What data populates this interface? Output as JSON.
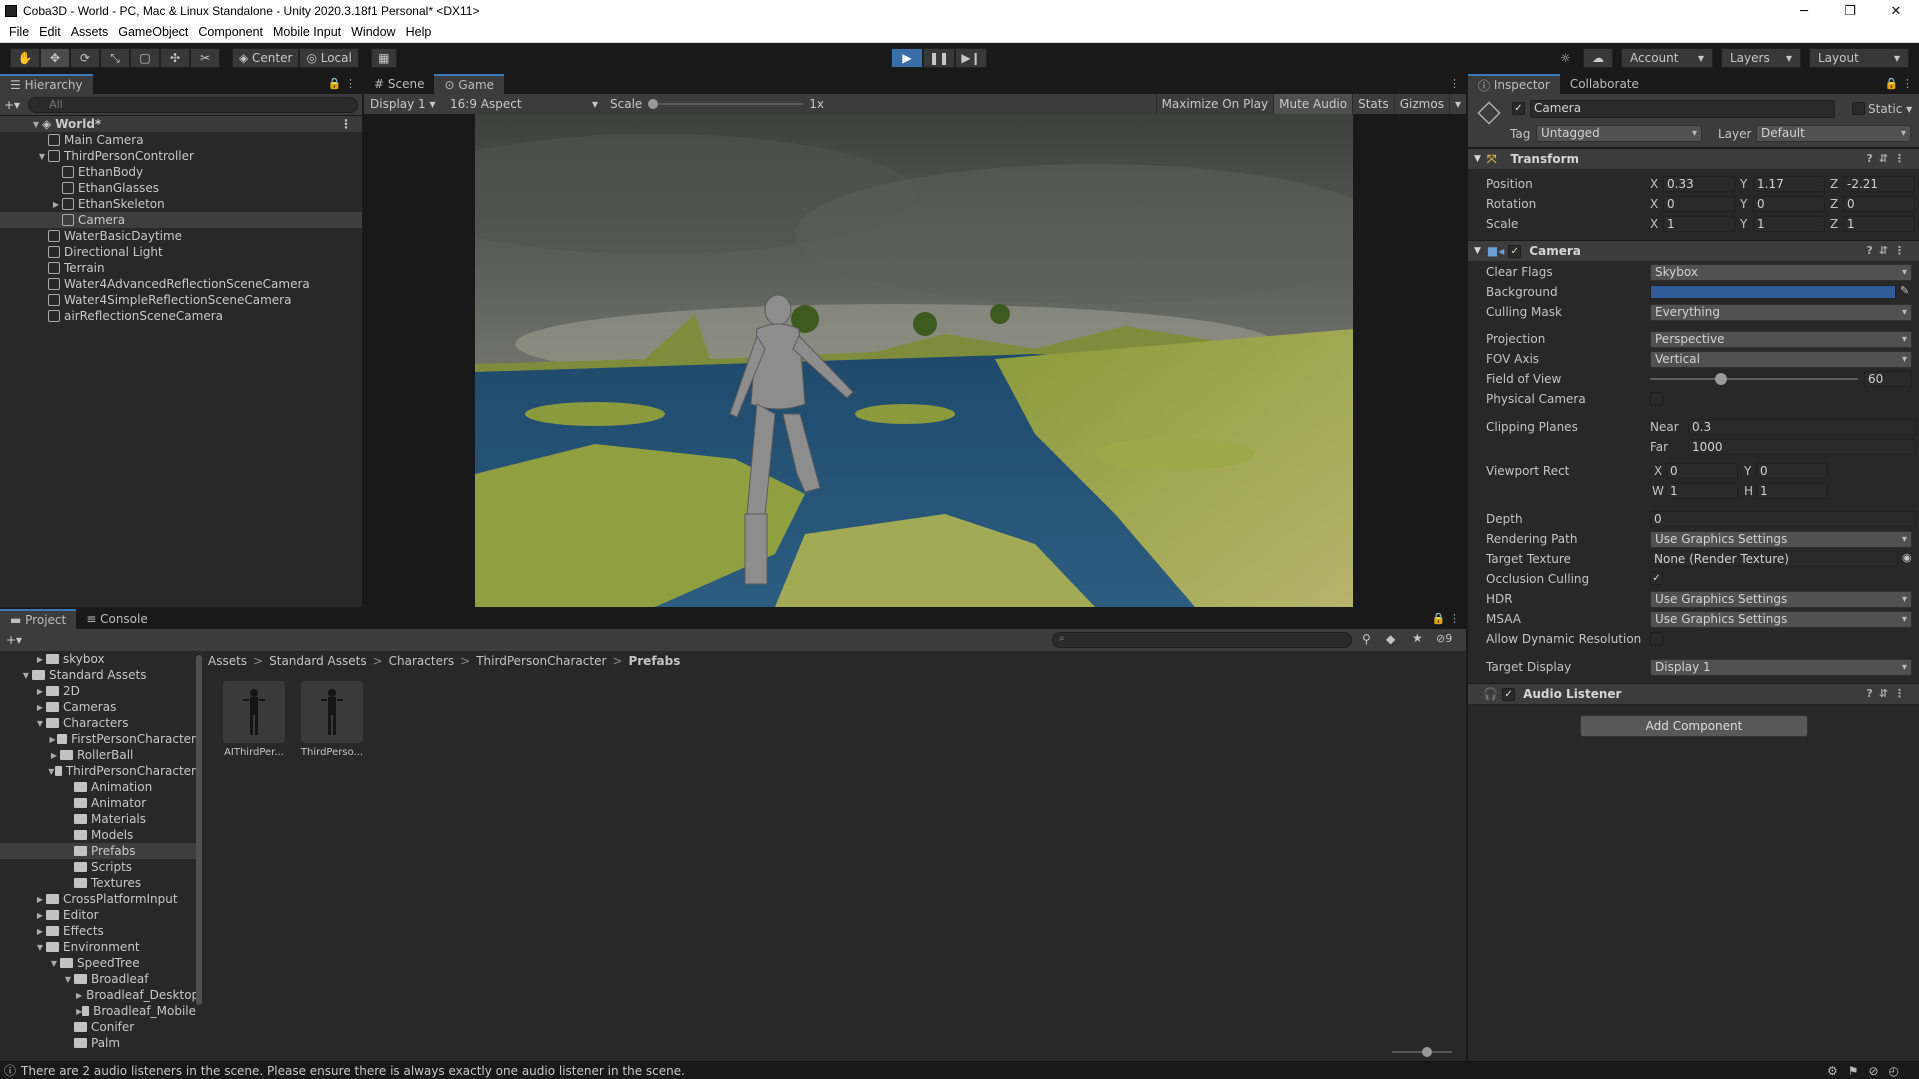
{
  "window": {
    "title": "Coba3D - World - PC, Mac & Linux Standalone - Unity 2020.3.18f1 Personal* <DX11>",
    "controls": [
      "─",
      "❐",
      "✕"
    ]
  },
  "menu": [
    "File",
    "Edit",
    "Assets",
    "GameObject",
    "Component",
    "Mobile Input",
    "Window",
    "Help"
  ],
  "toolbar": {
    "pivot": "Center",
    "space": "Local",
    "account": "Account",
    "layers": "Layers",
    "layout": "Layout"
  },
  "hierarchy": {
    "tab": "Hierarchy",
    "search_placeholder": "All",
    "scene": "World*",
    "items": [
      {
        "label": "Main Camera",
        "depth": 1
      },
      {
        "label": "ThirdPersonController",
        "depth": 1,
        "expanded": true
      },
      {
        "label": "EthanBody",
        "depth": 2
      },
      {
        "label": "EthanGlasses",
        "depth": 2
      },
      {
        "label": "EthanSkeleton",
        "depth": 2,
        "collapsed": true
      },
      {
        "label": "Camera",
        "depth": 2,
        "selected": true
      },
      {
        "label": "WaterBasicDaytime",
        "depth": 1
      },
      {
        "label": "Directional Light",
        "depth": 1
      },
      {
        "label": "Terrain",
        "depth": 1
      },
      {
        "label": "Water4AdvancedReflectionSceneCamera",
        "depth": 1
      },
      {
        "label": "Water4SimpleReflectionSceneCamera",
        "depth": 1
      },
      {
        "label": "airReflectionSceneCamera",
        "depth": 1
      }
    ]
  },
  "gameview": {
    "tabs": [
      "Scene",
      "Game"
    ],
    "display": "Display 1",
    "aspect": "16:9 Aspect",
    "scale_label": "Scale",
    "scale_value": "1x",
    "options": [
      "Maximize On Play",
      "Mute Audio",
      "Stats",
      "Gizmos"
    ]
  },
  "inspector": {
    "tabs": [
      "Inspector",
      "Collaborate"
    ],
    "object_name": "Camera",
    "static_label": "Static",
    "tag_label": "Tag",
    "tag_value": "Untagged",
    "layer_label": "Layer",
    "layer_value": "Default",
    "transform": {
      "title": "Transform",
      "position": {
        "label": "Position",
        "x": "0.33",
        "y": "1.17",
        "z": "-2.21"
      },
      "rotation": {
        "label": "Rotation",
        "x": "0",
        "y": "0",
        "z": "0"
      },
      "scale": {
        "label": "Scale",
        "x": "1",
        "y": "1",
        "z": "1"
      }
    },
    "camera": {
      "title": "Camera",
      "clear_flags": {
        "label": "Clear Flags",
        "value": "Skybox"
      },
      "background": {
        "label": "Background",
        "color": "#2f5c99"
      },
      "culling_mask": {
        "label": "Culling Mask",
        "value": "Everything"
      },
      "projection": {
        "label": "Projection",
        "value": "Perspective"
      },
      "fov_axis": {
        "label": "FOV Axis",
        "value": "Vertical"
      },
      "field_of_view": {
        "label": "Field of View",
        "value": "60",
        "fraction": 0.33
      },
      "physical_camera": {
        "label": "Physical Camera"
      },
      "clipping": {
        "label": "Clipping Planes",
        "near_label": "Near",
        "near": "0.3",
        "far_label": "Far",
        "far": "1000"
      },
      "viewport": {
        "label": "Viewport Rect",
        "x": "0",
        "y": "0",
        "w": "1",
        "h": "1"
      },
      "depth": {
        "label": "Depth",
        "value": "0"
      },
      "rendering_path": {
        "label": "Rendering Path",
        "value": "Use Graphics Settings"
      },
      "target_texture": {
        "label": "Target Texture",
        "value": "None (Render Texture)"
      },
      "occlusion": {
        "label": "Occlusion Culling"
      },
      "hdr": {
        "label": "HDR",
        "value": "Use Graphics Settings"
      },
      "msaa": {
        "label": "MSAA",
        "value": "Use Graphics Settings"
      },
      "dynamic_resolution": {
        "label": "Allow Dynamic Resolution"
      },
      "target_display": {
        "label": "Target Display",
        "value": "Display 1"
      }
    },
    "audio_listener": {
      "title": "Audio Listener"
    },
    "add_component": "Add Component"
  },
  "project": {
    "tabs": [
      "Project",
      "Console"
    ],
    "hidden_count": "9",
    "tree": [
      {
        "label": "skybox",
        "depth": 1
      },
      {
        "label": "Standard Assets",
        "depth": 0,
        "open": true
      },
      {
        "label": "2D",
        "depth": 1
      },
      {
        "label": "Cameras",
        "depth": 1
      },
      {
        "label": "Characters",
        "depth": 1,
        "open": true
      },
      {
        "label": "FirstPersonCharacter",
        "depth": 2
      },
      {
        "label": "RollerBall",
        "depth": 2
      },
      {
        "label": "ThirdPersonCharacter",
        "depth": 2,
        "open": true
      },
      {
        "label": "Animation",
        "depth": 3
      },
      {
        "label": "Animator",
        "depth": 3
      },
      {
        "label": "Materials",
        "depth": 3
      },
      {
        "label": "Models",
        "depth": 3
      },
      {
        "label": "Prefabs",
        "depth": 3,
        "selected": true
      },
      {
        "label": "Scripts",
        "depth": 3
      },
      {
        "label": "Textures",
        "depth": 3
      },
      {
        "label": "CrossPlatformInput",
        "depth": 1
      },
      {
        "label": "Editor",
        "depth": 1
      },
      {
        "label": "Effects",
        "depth": 1
      },
      {
        "label": "Environment",
        "depth": 1,
        "open": true
      },
      {
        "label": "SpeedTree",
        "depth": 2,
        "open": true
      },
      {
        "label": "Broadleaf",
        "depth": 3,
        "open": true
      },
      {
        "label": "Broadleaf_Desktop",
        "depth": 4
      },
      {
        "label": "Broadleaf_Mobile",
        "depth": 4
      },
      {
        "label": "Conifer",
        "depth": 3
      },
      {
        "label": "Palm",
        "depth": 3
      }
    ],
    "breadcrumb": [
      "Assets",
      "Standard Assets",
      "Characters",
      "ThirdPersonCharacter",
      "Prefabs"
    ],
    "assets": [
      {
        "label": "AIThirdPer..."
      },
      {
        "label": "ThirdPerso..."
      }
    ]
  },
  "status": {
    "message": "There are 2 audio listeners in the scene. Please ensure there is always exactly one audio listener in the scene."
  }
}
